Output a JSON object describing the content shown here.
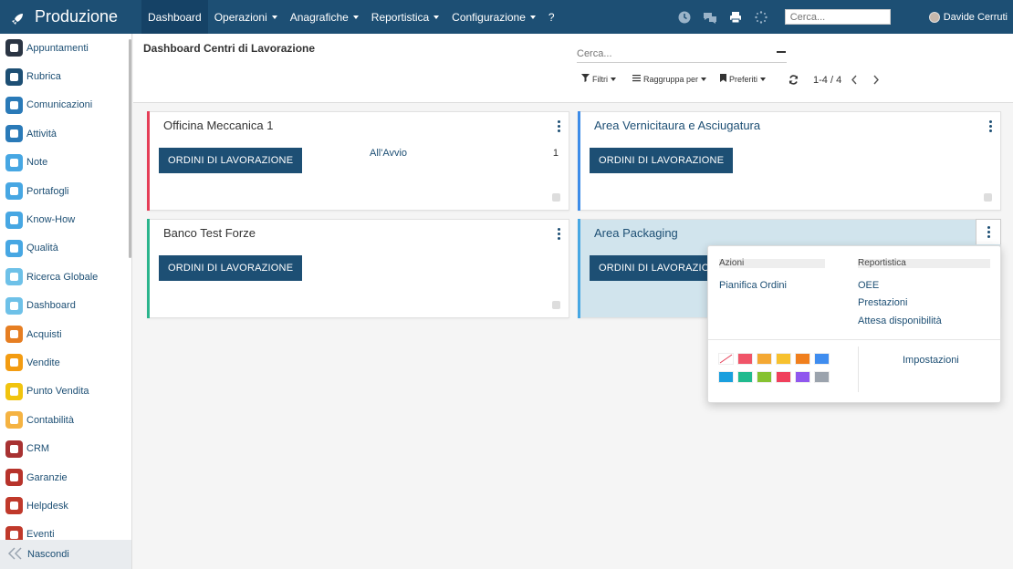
{
  "app": {
    "name": "Produzione"
  },
  "topnav": [
    {
      "label": "Dashboard",
      "dropdown": false
    },
    {
      "label": "Operazioni",
      "dropdown": true
    },
    {
      "label": "Anagrafiche",
      "dropdown": true
    },
    {
      "label": "Reportistica",
      "dropdown": true
    },
    {
      "label": "Configurazione",
      "dropdown": true
    },
    {
      "label": "?",
      "dropdown": false
    }
  ],
  "search": {
    "placeholder": "Cerca..."
  },
  "user": {
    "name": "Davide Cerruti"
  },
  "sidebar": {
    "items": [
      {
        "label": "Appuntamenti",
        "icon": "calendar-icon",
        "color": "#2b3544"
      },
      {
        "label": "Rubrica",
        "icon": "contacts-icon",
        "color": "#1d4f74"
      },
      {
        "label": "Comunicazioni",
        "icon": "chat-icon",
        "color": "#2a7ab8"
      },
      {
        "label": "Attività",
        "icon": "checkbox-icon",
        "color": "#2a7ab8"
      },
      {
        "label": "Note",
        "icon": "note-icon",
        "color": "#47a7e3"
      },
      {
        "label": "Portafogli",
        "icon": "lock-icon",
        "color": "#47a7e3"
      },
      {
        "label": "Know-How",
        "icon": "brain-icon",
        "color": "#47a7e3"
      },
      {
        "label": "Qualità",
        "icon": "quality-icon",
        "color": "#47a7e3"
      },
      {
        "label": "Ricerca Globale",
        "icon": "search-icon",
        "color": "#6ec1e8"
      },
      {
        "label": "Dashboard",
        "icon": "dashboard-icon",
        "color": "#6ec1e8"
      },
      {
        "label": "Acquisti",
        "icon": "purchase-icon",
        "color": "#e67e22"
      },
      {
        "label": "Vendite",
        "icon": "chart-icon",
        "color": "#f39c12"
      },
      {
        "label": "Punto Vendita",
        "icon": "pos-icon",
        "color": "#f1c40f"
      },
      {
        "label": "Contabilità",
        "icon": "accounting-icon",
        "color": "#f5b342"
      },
      {
        "label": "CRM",
        "icon": "handshake-icon",
        "color": "#a83232"
      },
      {
        "label": "Garanzie",
        "icon": "shield-icon",
        "color": "#b7332b"
      },
      {
        "label": "Helpdesk",
        "icon": "headset-icon",
        "color": "#c0392b"
      },
      {
        "label": "Eventi",
        "icon": "ticket-icon",
        "color": "#c0392b"
      }
    ],
    "footer_label": "Nascondi"
  },
  "control_panel": {
    "title": "Dashboard Centri di Lavorazione",
    "search_placeholder": "Cerca...",
    "filters_label": "Filtri",
    "groupby_label": "Raggruppa per",
    "favorites_label": "Preferiti",
    "pager": "1-4 / 4"
  },
  "cards": [
    {
      "title": "Officina Meccanica 1",
      "button": "ORDINI DI LAVORAZIONE",
      "stat_label": "All'Avvio",
      "stat_value": "1",
      "color": "#e53e57"
    },
    {
      "title": "Area Vernicitaura e Asciugatura",
      "button": "ORDINI DI LAVORAZIONE",
      "color": "#3c8be8"
    },
    {
      "title": "Banco Test Forze",
      "button": "ORDINI DI LAVORAZIONE",
      "color": "#2bb48c"
    },
    {
      "title": "Area Packaging",
      "button": "ORDINI DI LAVORAZIONE",
      "color": "#47a7e3"
    }
  ],
  "dropdown": {
    "actions_header": "Azioni",
    "actions": [
      "Pianifica Ordini"
    ],
    "reports_header": "Reportistica",
    "reports": [
      "OEE",
      "Prestazioni",
      "Attesa disponibilità"
    ],
    "settings_label": "Impostazioni",
    "colors": [
      "none",
      "#f05468",
      "#f4a833",
      "#f7c12e",
      "#f07f1d",
      "#3f8def",
      "#1a9fde",
      "#20ba8e",
      "#86c231",
      "#f0405c",
      "#9057ee",
      "#9ba3ad"
    ]
  }
}
